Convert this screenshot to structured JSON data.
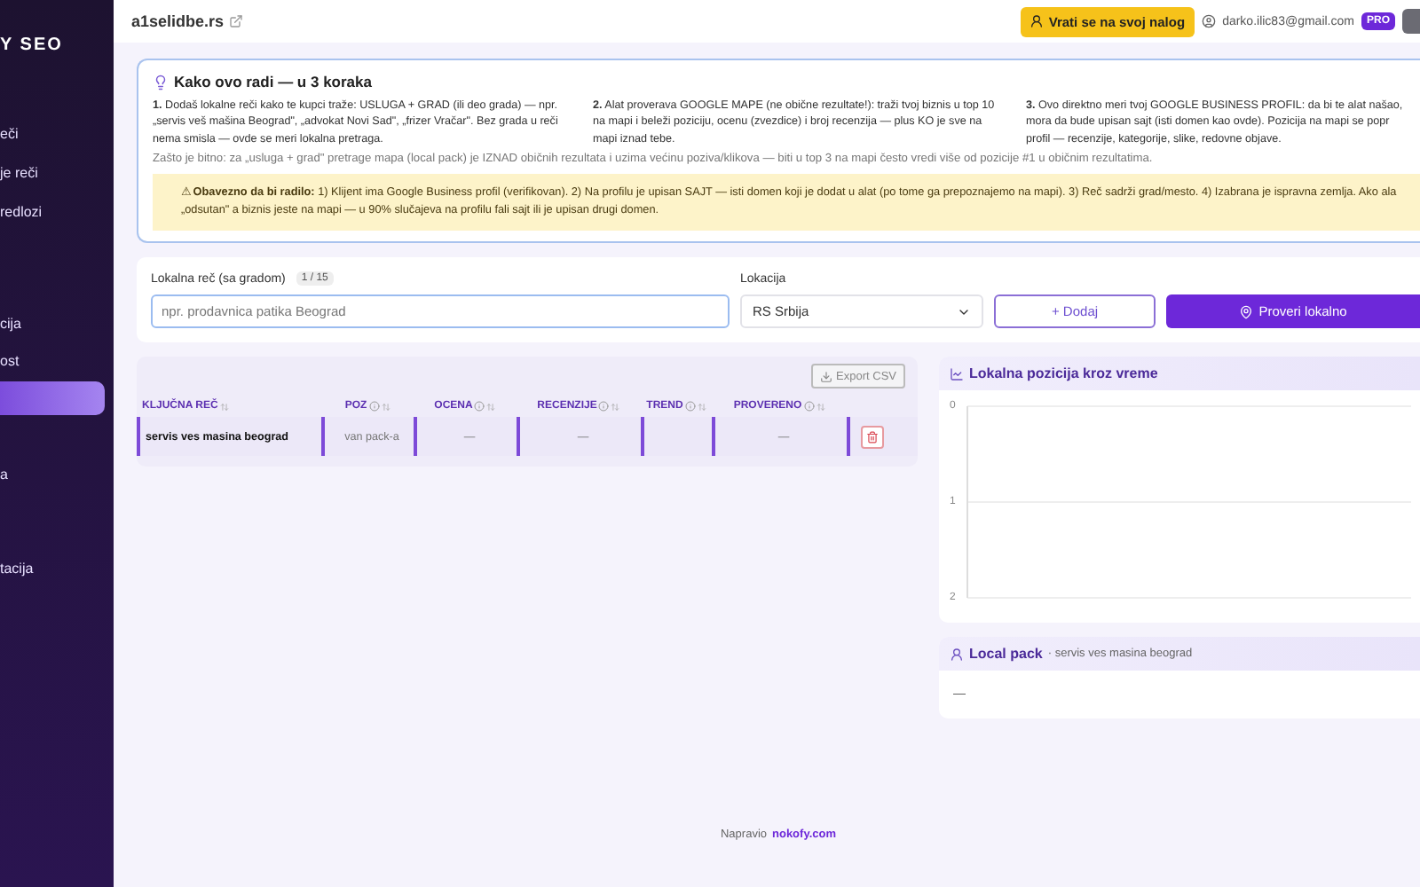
{
  "sidebar": {
    "brand": "Y SEO",
    "items": [
      {
        "label": "eči",
        "selected": false
      },
      {
        "label": "je reči",
        "selected": false
      },
      {
        "label": "redlozi",
        "selected": false
      },
      {
        "label": "cija",
        "selected": false
      },
      {
        "label": "ost",
        "selected": false
      },
      {
        "selected": true
      },
      {
        "label": "a",
        "selected": false
      },
      {
        "label": "tacija",
        "selected": false
      }
    ]
  },
  "topbar": {
    "site": "a1selidbe.rs",
    "back_button": "Vrati se na svoj nalog",
    "email": "darko.ilic83@gmail.com",
    "plan_badge": "PRO"
  },
  "info": {
    "title": "Kako ovo radi — u 3 koraka",
    "steps": [
      {
        "num": "1.",
        "text": "Dodaš lokalne reči kako te kupci traže: USLUGA + GRAD (ili deo grada) — npr. „servis veš mašina Beograd\", „advokat Novi Sad\", „frizer Vračar\". Bez grada u reči nema smisla — ovde se meri lokalna pretraga."
      },
      {
        "num": "2.",
        "text": "Alat proverava GOOGLE MAPE (ne obične rezultate!): traži tvoj biznis u top 10 na mapi i beleži poziciju, ocenu (zvezdice) i broj recenzija — plus KO je sve na mapi iznad tebe."
      },
      {
        "num": "3.",
        "text": "Ovo direktno meri tvoj GOOGLE BUSINESS PROFIL: da bi te alat našao,\nmora da bude upisan sajt (isti domen kao ovde). Pozicija na mapi se popr\nprofil — recenzije, kategorije, slike, redovne objave."
      }
    ],
    "why": "Zašto je bitno: za „usluga + grad\" pretrage mapa (local pack) je IZNAD običnih rezultata i uzima većinu poziva/klikova — biti u top 3 na mapi često vredi više od pozicije #1 u običnim rezultatima.",
    "warning": "⚠ **Obavezno da bi radilo:** 1) Klijent ima Google Business profil (verifikovan). 2) Na profilu je upisan SAJT — isti domen koji je dodat u alat (po tome ga prepoznajemo na mapi). 3) Reč sadrži grad/mesto. 4) Izabrana je ispravna zemlja. Ako ala\n„odsutan\" a biznis jeste na mapi — u 90% slučajeva na profilu fali sajt ili je upisan drugi domen."
  },
  "form": {
    "keyword_label": "Lokalna reč (sa gradom)",
    "count": "1 / 15",
    "keyword_placeholder": "npr. prodavnica patika Beograd",
    "location_label": "Lokacija",
    "location": "RS Srbija",
    "add_button": "+ Dodaj",
    "check_button": "Proveri lokalno"
  },
  "table": {
    "export_button": "Export CSV",
    "columns": [
      {
        "label": "KLJUČNA REČ",
        "kind": "plain"
      },
      {
        "label": "POZ",
        "kind": "info"
      },
      {
        "label": "OCENA",
        "kind": "info"
      },
      {
        "label": "RECENZIJE",
        "kind": "info"
      },
      {
        "label": "TREND",
        "kind": "info"
      },
      {
        "label": "PROVERENO",
        "kind": "info"
      }
    ],
    "rows": [
      {
        "cells": [
          "servis ves masina beograd",
          "van pack-a",
          "—",
          "—",
          "",
          "—"
        ]
      }
    ]
  },
  "chart": {
    "title": "Lokalna pozicija kroz vreme",
    "axis_labels": [
      "0",
      "1",
      "2"
    ]
  },
  "local_pack": {
    "title": "Local pack",
    "subtitle": "· servis ves masina beograd",
    "empty": "—"
  },
  "footer": {
    "text": "Napravio",
    "link": "nokofy.com"
  }
}
